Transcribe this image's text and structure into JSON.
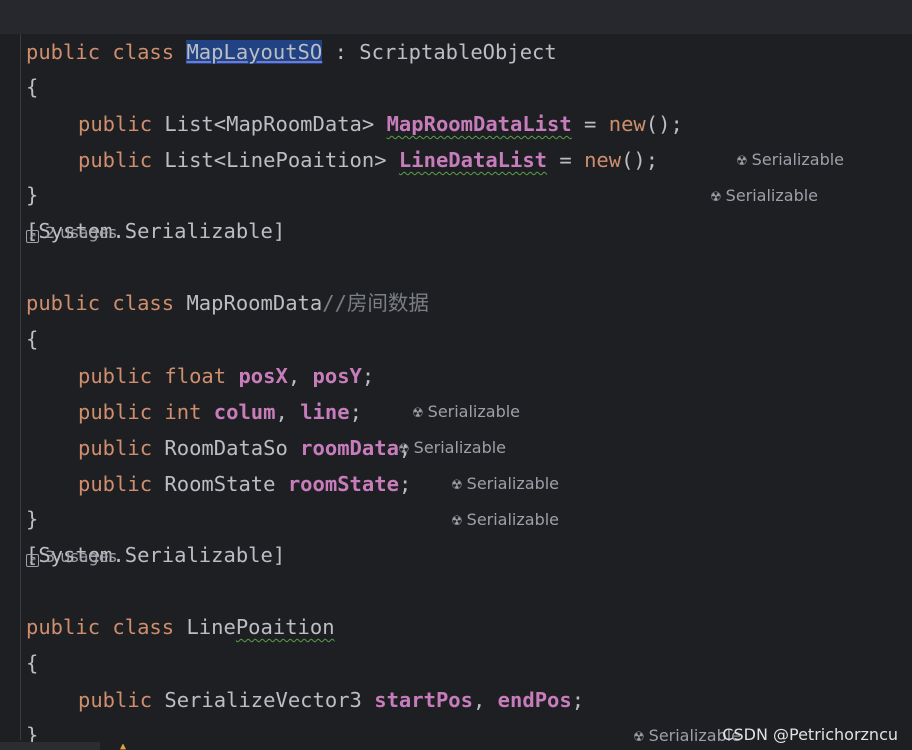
{
  "editor": {
    "language": "csharp",
    "class1": {
      "kw_public": "public",
      "kw_class": "class",
      "name": "MapLayoutSO",
      "sep": " : ",
      "base": "ScriptableObject",
      "open": "{",
      "close": "}",
      "fields": [
        {
          "kw": "public",
          "type": "List<MapRoomData>",
          "name": "MapRoomDataList",
          "assign": " = ",
          "kw_new": "new",
          "tail": "();",
          "hint": "Serializable"
        },
        {
          "kw": "public",
          "type": "List<LinePoaition>",
          "name": "LineDataList",
          "assign": " = ",
          "kw_new": "new",
          "tail": "();",
          "hint": "Serializable"
        }
      ]
    },
    "attr1": "[System.Serializable]",
    "usages1": "2 usages",
    "class2": {
      "kw_public": "public",
      "kw_class": "class",
      "name": "MapRoomData",
      "comment": "//房间数据",
      "open": "{",
      "close": "}",
      "fields": [
        {
          "kw": "public",
          "type": "float",
          "name1": "posX",
          "sep": ", ",
          "name2": "posY",
          "end": ";",
          "hint": "Serializable"
        },
        {
          "kw": "public",
          "type": "int",
          "name1": "colum",
          "sep": ", ",
          "name2": "line",
          "end": ";",
          "hint": "Serializable"
        },
        {
          "kw": "public",
          "type": "RoomDataSo",
          "name1": "roomData",
          "end": ";",
          "hint": "Serializable"
        },
        {
          "kw": "public",
          "type": "RoomState",
          "name1": "roomState",
          "end": ";",
          "hint": "Serializable"
        }
      ]
    },
    "attr2": "[System.Serializable]",
    "usages2": "3 usages",
    "class3": {
      "kw_public": "public",
      "kw_class": "class",
      "name_a": "Line",
      "name_b": "Poaition",
      "open": "{",
      "close": "}",
      "field": {
        "kw": "public",
        "type": "SerializeVector3",
        "name1": "startPos",
        "sep": ", ",
        "name2": "endPos",
        "end": ";",
        "hint": "Serializable"
      }
    }
  },
  "watermark": "CSDN @Petrichorzncu",
  "icons": {
    "serializable_hint": "radiation-icon",
    "usages": "arrow-up-right-icon"
  }
}
